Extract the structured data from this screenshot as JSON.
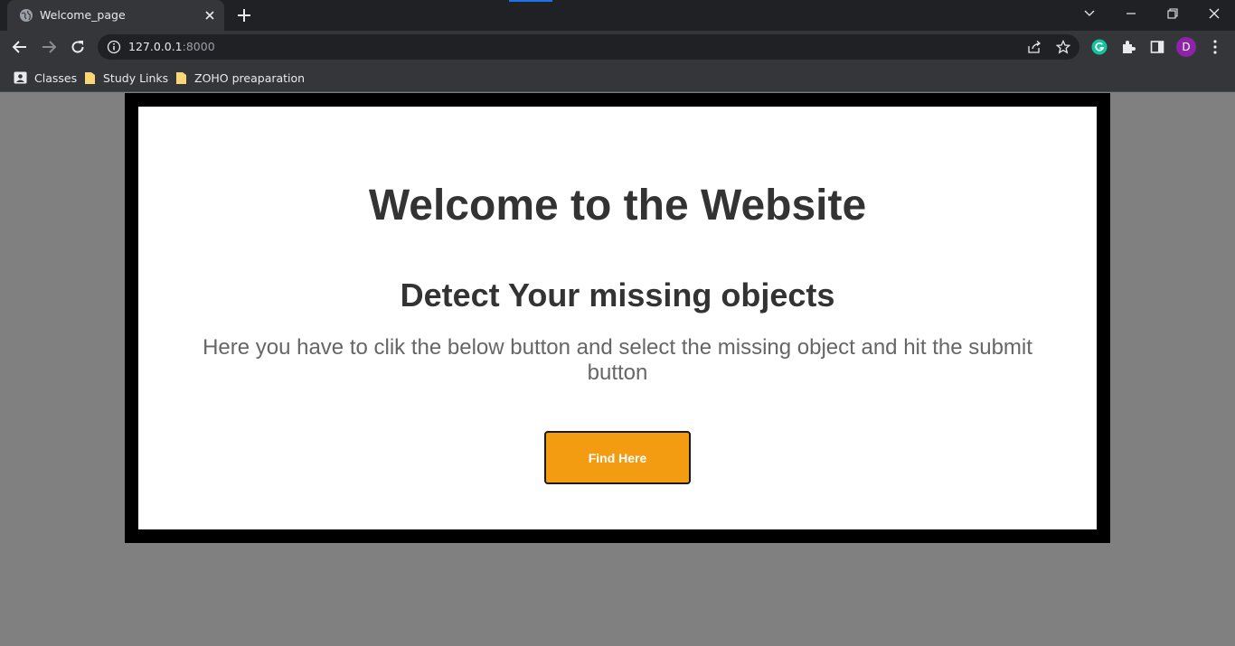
{
  "browser": {
    "tab": {
      "title": "Welcome_page"
    },
    "url": {
      "host": "127.0.0.1",
      "port": ":8000"
    },
    "profile_initial": "D",
    "bookmarks": [
      {
        "label": "Classes",
        "icon": "profile-bookmark-icon"
      },
      {
        "label": "Study Links",
        "icon": "folder-icon"
      },
      {
        "label": "ZOHO preaparation",
        "icon": "folder-icon"
      }
    ]
  },
  "page": {
    "heading": "Welcome to the Website",
    "subheading": "Detect Your missing objects",
    "description": "Here you have to clik the below button and select the missing object and hit the submit button",
    "button_label": "Find Here",
    "colors": {
      "button": "#f39c12",
      "frame": "#000000",
      "background": "#808080",
      "heading": "#333333",
      "description": "#666666"
    }
  }
}
